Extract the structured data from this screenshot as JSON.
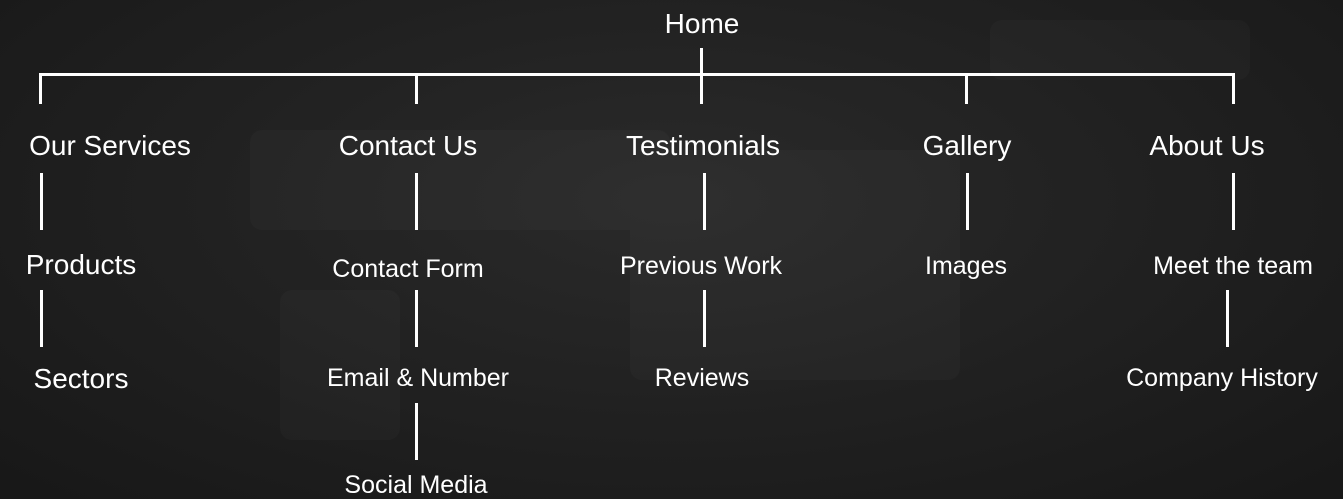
{
  "sitemap": {
    "root": {
      "label": "Home"
    },
    "sections": [
      {
        "label": "Our Services",
        "children": [
          "Products",
          "Sectors"
        ]
      },
      {
        "label": "Contact Us",
        "children": [
          "Contact Form",
          "Email & Number",
          "Social Media"
        ]
      },
      {
        "label": "Testimonials",
        "children": [
          "Previous Work",
          "Reviews"
        ]
      },
      {
        "label": "Gallery",
        "children": [
          "Images"
        ]
      },
      {
        "label": "About Us",
        "children": [
          "Meet the team",
          "Company History"
        ]
      }
    ]
  },
  "colors": {
    "background": "#242424",
    "text": "#ffffff",
    "connector": "#ffffff"
  }
}
